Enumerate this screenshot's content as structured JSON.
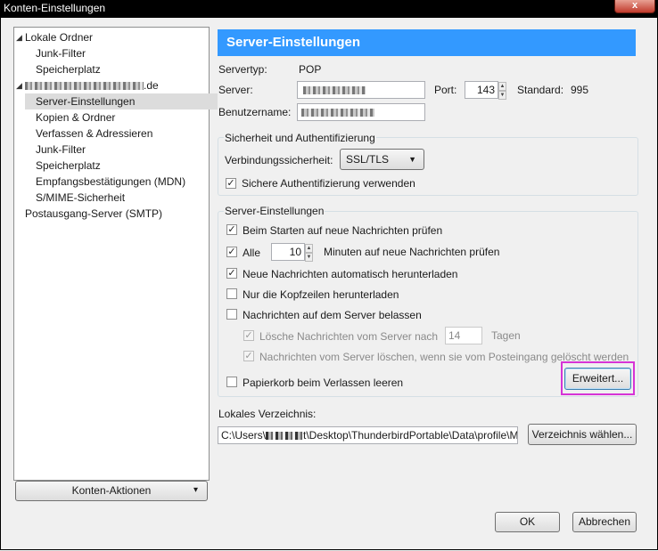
{
  "window": {
    "title": "Konten-Einstellungen",
    "close": "x"
  },
  "tree": {
    "items": [
      {
        "label": "Lokale Ordner",
        "twisty": "◢"
      },
      {
        "label": "Junk-Filter"
      },
      {
        "label": "Speicherplatz"
      },
      {
        "label": ".de",
        "twisty": "◢"
      },
      {
        "label": "Server-Einstellungen",
        "selected": true
      },
      {
        "label": "Kopien & Ordner"
      },
      {
        "label": "Verfassen & Adressieren"
      },
      {
        "label": "Junk-Filter"
      },
      {
        "label": "Speicherplatz"
      },
      {
        "label": "Empfangsbestätigungen (MDN)"
      },
      {
        "label": "S/MIME-Sicherheit"
      },
      {
        "label": "Postausgang-Server (SMTP)"
      }
    ]
  },
  "konten_aktionen": {
    "label": "Konten-Aktionen",
    "arrow": "▾"
  },
  "main": {
    "header": "Server-Einstellungen",
    "servertyp_label": "Servertyp:",
    "servertyp_value": "POP",
    "server_label": "Server:",
    "port_label": "Port:",
    "port_value": "143",
    "standard_label": "Standard:",
    "standard_value": "995",
    "benutzername_label": "Benutzername:"
  },
  "security": {
    "legend": "Sicherheit und Authentifizierung",
    "verbindung_label": "Verbindungssicherheit:",
    "verbindung_value": "SSL/TLS",
    "sichere_auth": "Sichere Authentifizierung verwenden"
  },
  "server_settings": {
    "legend": "Server-Einstellungen",
    "beim_starten": "Beim Starten auf neue Nachrichten prüfen",
    "alle": "Alle",
    "alle_value": "10",
    "minuten": "Minuten auf neue Nachrichten prüfen",
    "neue_nachrichten": "Neue Nachrichten automatisch herunterladen",
    "nur_kopfzeilen": "Nur die Kopfzeilen herunterladen",
    "belassen": "Nachrichten auf dem Server belassen",
    "loesche": "Lösche Nachrichten vom Server nach",
    "loesche_value": "14",
    "tagen": "Tagen",
    "nachrichten_loeschen": "Nachrichten vom Server löschen, wenn sie vom Posteingang gelöscht werden",
    "papierkorb": "Papierkorb beim Verlassen leeren",
    "erweitert": "Erweitert..."
  },
  "local_dir": {
    "label": "Lokales Verzeichnis:",
    "path_start": "C:\\Users\\",
    "path_end": "t\\Desktop\\ThunderbirdPortable\\Data\\profile\\M",
    "choose": "Verzeichnis wählen..."
  },
  "footer": {
    "ok": "OK",
    "cancel": "Abbrechen"
  },
  "colors": {
    "header_bg": "#3399ff",
    "highlight_border": "#d633d6"
  }
}
